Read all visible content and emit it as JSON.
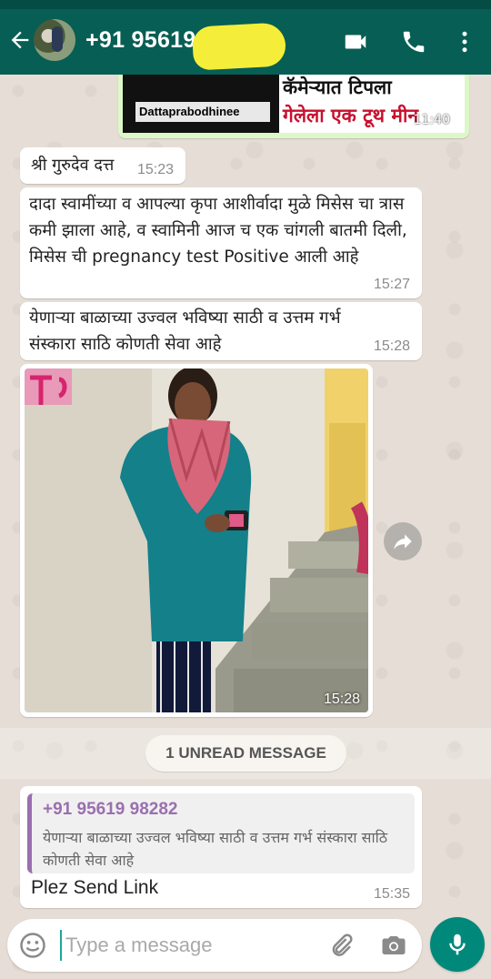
{
  "header": {
    "contact": "+91 95619",
    "icons": [
      "back-arrow-icon",
      "video-call-icon",
      "phone-icon",
      "more-options-icon"
    ]
  },
  "banner": {
    "caption": "Dattaprabodhinee",
    "title_line1": "कॅमेऱ्यात टिपला",
    "title_line2": "गेलेला एक टूथ मीन",
    "time": "11:40"
  },
  "messages": [
    {
      "text": "श्री गुरुदेव दत्त",
      "time": "15:23"
    },
    {
      "text": "दादा स्वामींच्या व आपल्या कृपा आशीर्वादा मुळे मिसेस चा त्रास कमी झाला आहे, व स्वामिनी आज च एक चांगली बातमी दिली, मिसेस ची pregnancy test Positive आली आहे",
      "time": "15:27"
    },
    {
      "text": "येणाऱ्या बाळाच्या उज्वल भविष्या साठी व उत्तम गर्भ संस्कारा साठि कोणती सेवा आहे",
      "time": "15:28"
    },
    {
      "time": "15:28"
    }
  ],
  "unread_label": "1 UNREAD MESSAGE",
  "reply": {
    "quoted_author": "+91 95619 98282",
    "quoted_text": "येणाऱ्या बाळाच्या उज्वल भविष्या साठी व उत्तम गर्भ संस्कारा साठि कोणती सेवा आहे",
    "text": "Plez Send Link",
    "time": "15:35"
  },
  "composer": {
    "placeholder": "Type a message",
    "icons": [
      "emoji-icon",
      "attach-icon",
      "camera-icon",
      "mic-icon"
    ]
  },
  "colors": {
    "header": "#075e54",
    "outgoing_bubble": "#dcf8c6",
    "incoming_bubble": "#ffffff",
    "accent": "#00897b"
  }
}
